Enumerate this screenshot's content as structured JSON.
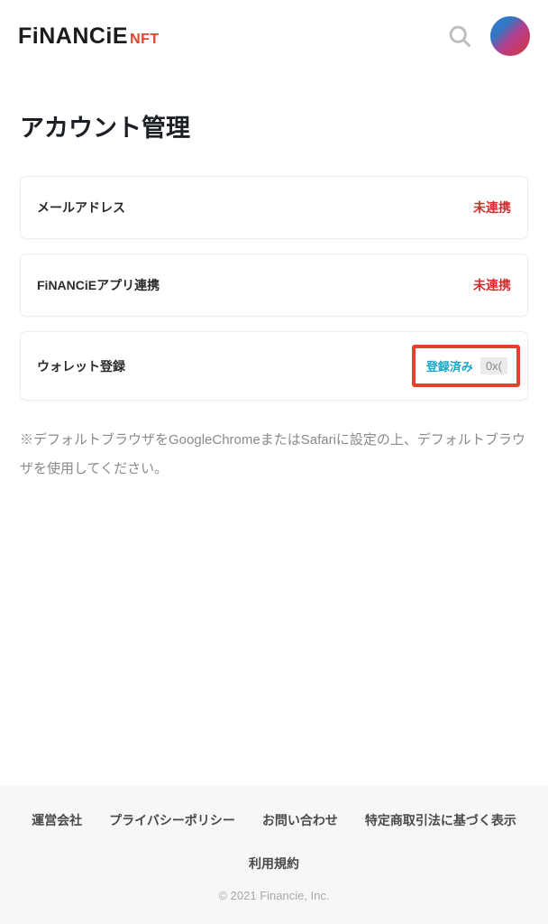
{
  "header": {
    "logo_main": "FiNANCiE",
    "logo_sub": "NFT"
  },
  "page": {
    "title": "アカウント管理"
  },
  "cards": {
    "email": {
      "label": "メールアドレス",
      "status": "未連携"
    },
    "app": {
      "label": "FiNANCiEアプリ連携",
      "status": "未連携"
    },
    "wallet": {
      "label": "ウォレット登録",
      "status": "登録済み",
      "value": "0x("
    }
  },
  "note": "※デフォルトブラウザをGoogleChromeまたはSafariに設定の上、デフォルトブラウザを使用してください。",
  "footer": {
    "links": [
      "運営会社",
      "プライバシーポリシー",
      "お問い合わせ",
      "特定商取引法に基づく表示",
      "利用規約"
    ],
    "copyright": "© 2021 Financie, Inc."
  }
}
